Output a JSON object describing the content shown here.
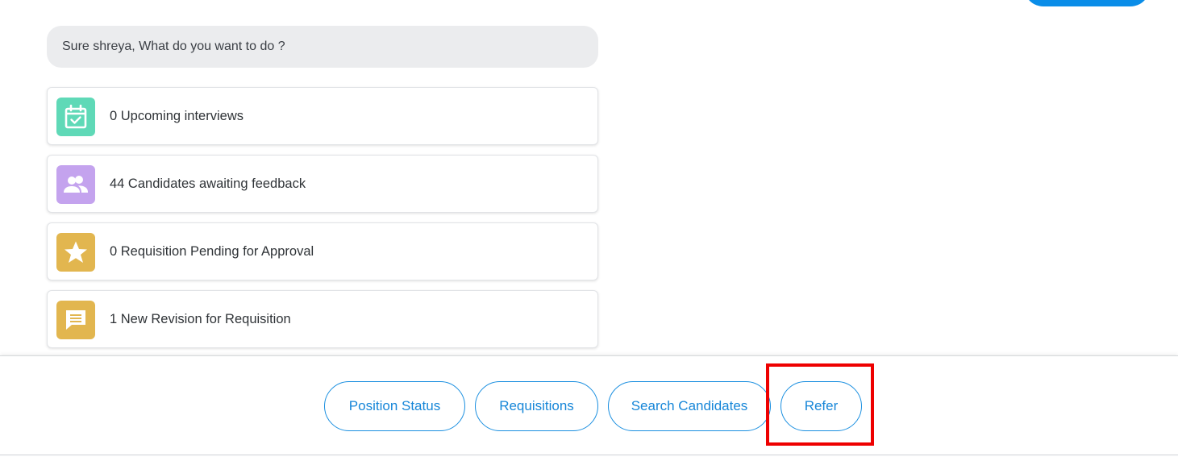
{
  "chat": {
    "bot_message": "Sure shreya, What do you want to do ?"
  },
  "cards": [
    {
      "label": "0 Upcoming interviews",
      "icon": "calendar-check-icon",
      "color": "#5fd9b7"
    },
    {
      "label": "44 Candidates awaiting feedback",
      "icon": "people-icon",
      "color": "#c4a3ee"
    },
    {
      "label": "0 Requisition Pending for Approval",
      "icon": "star-icon",
      "color": "#e2b64f"
    },
    {
      "label": "1 New Revision for Requisition",
      "icon": "message-icon",
      "color": "#e2b64f"
    }
  ],
  "quick_replies": [
    {
      "label": "Position Status"
    },
    {
      "label": "Requisitions"
    },
    {
      "label": "Search Candidates"
    },
    {
      "label": "Refer"
    }
  ],
  "colors": {
    "accent": "#1686d8",
    "user_bubble": "#0a8de8",
    "bot_bubble": "#ebecee",
    "highlight": "#ee0000"
  }
}
